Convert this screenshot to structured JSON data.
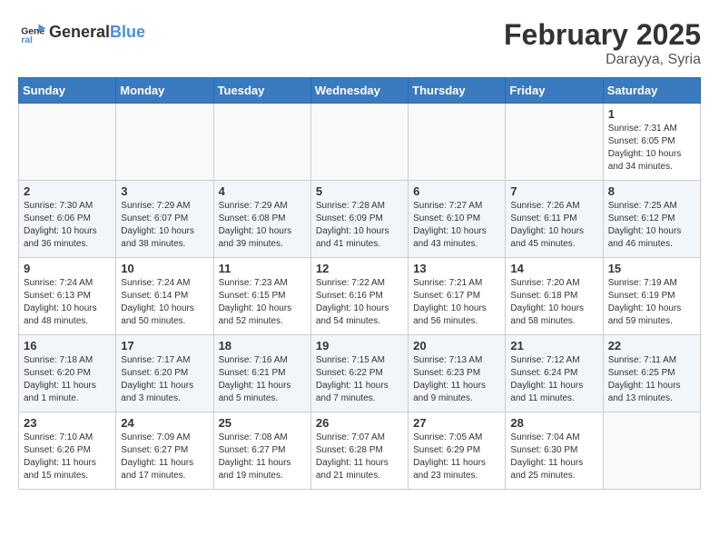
{
  "header": {
    "logo_line1": "General",
    "logo_line2": "Blue",
    "month": "February 2025",
    "location": "Darayya, Syria"
  },
  "days_of_week": [
    "Sunday",
    "Monday",
    "Tuesday",
    "Wednesday",
    "Thursday",
    "Friday",
    "Saturday"
  ],
  "weeks": [
    [
      {
        "day": "",
        "info": ""
      },
      {
        "day": "",
        "info": ""
      },
      {
        "day": "",
        "info": ""
      },
      {
        "day": "",
        "info": ""
      },
      {
        "day": "",
        "info": ""
      },
      {
        "day": "",
        "info": ""
      },
      {
        "day": "1",
        "info": "Sunrise: 7:31 AM\nSunset: 6:05 PM\nDaylight: 10 hours and 34 minutes."
      }
    ],
    [
      {
        "day": "2",
        "info": "Sunrise: 7:30 AM\nSunset: 6:06 PM\nDaylight: 10 hours and 36 minutes."
      },
      {
        "day": "3",
        "info": "Sunrise: 7:29 AM\nSunset: 6:07 PM\nDaylight: 10 hours and 38 minutes."
      },
      {
        "day": "4",
        "info": "Sunrise: 7:29 AM\nSunset: 6:08 PM\nDaylight: 10 hours and 39 minutes."
      },
      {
        "day": "5",
        "info": "Sunrise: 7:28 AM\nSunset: 6:09 PM\nDaylight: 10 hours and 41 minutes."
      },
      {
        "day": "6",
        "info": "Sunrise: 7:27 AM\nSunset: 6:10 PM\nDaylight: 10 hours and 43 minutes."
      },
      {
        "day": "7",
        "info": "Sunrise: 7:26 AM\nSunset: 6:11 PM\nDaylight: 10 hours and 45 minutes."
      },
      {
        "day": "8",
        "info": "Sunrise: 7:25 AM\nSunset: 6:12 PM\nDaylight: 10 hours and 46 minutes."
      }
    ],
    [
      {
        "day": "9",
        "info": "Sunrise: 7:24 AM\nSunset: 6:13 PM\nDaylight: 10 hours and 48 minutes."
      },
      {
        "day": "10",
        "info": "Sunrise: 7:24 AM\nSunset: 6:14 PM\nDaylight: 10 hours and 50 minutes."
      },
      {
        "day": "11",
        "info": "Sunrise: 7:23 AM\nSunset: 6:15 PM\nDaylight: 10 hours and 52 minutes."
      },
      {
        "day": "12",
        "info": "Sunrise: 7:22 AM\nSunset: 6:16 PM\nDaylight: 10 hours and 54 minutes."
      },
      {
        "day": "13",
        "info": "Sunrise: 7:21 AM\nSunset: 6:17 PM\nDaylight: 10 hours and 56 minutes."
      },
      {
        "day": "14",
        "info": "Sunrise: 7:20 AM\nSunset: 6:18 PM\nDaylight: 10 hours and 58 minutes."
      },
      {
        "day": "15",
        "info": "Sunrise: 7:19 AM\nSunset: 6:19 PM\nDaylight: 10 hours and 59 minutes."
      }
    ],
    [
      {
        "day": "16",
        "info": "Sunrise: 7:18 AM\nSunset: 6:20 PM\nDaylight: 11 hours and 1 minute."
      },
      {
        "day": "17",
        "info": "Sunrise: 7:17 AM\nSunset: 6:20 PM\nDaylight: 11 hours and 3 minutes."
      },
      {
        "day": "18",
        "info": "Sunrise: 7:16 AM\nSunset: 6:21 PM\nDaylight: 11 hours and 5 minutes."
      },
      {
        "day": "19",
        "info": "Sunrise: 7:15 AM\nSunset: 6:22 PM\nDaylight: 11 hours and 7 minutes."
      },
      {
        "day": "20",
        "info": "Sunrise: 7:13 AM\nSunset: 6:23 PM\nDaylight: 11 hours and 9 minutes."
      },
      {
        "day": "21",
        "info": "Sunrise: 7:12 AM\nSunset: 6:24 PM\nDaylight: 11 hours and 11 minutes."
      },
      {
        "day": "22",
        "info": "Sunrise: 7:11 AM\nSunset: 6:25 PM\nDaylight: 11 hours and 13 minutes."
      }
    ],
    [
      {
        "day": "23",
        "info": "Sunrise: 7:10 AM\nSunset: 6:26 PM\nDaylight: 11 hours and 15 minutes."
      },
      {
        "day": "24",
        "info": "Sunrise: 7:09 AM\nSunset: 6:27 PM\nDaylight: 11 hours and 17 minutes."
      },
      {
        "day": "25",
        "info": "Sunrise: 7:08 AM\nSunset: 6:27 PM\nDaylight: 11 hours and 19 minutes."
      },
      {
        "day": "26",
        "info": "Sunrise: 7:07 AM\nSunset: 6:28 PM\nDaylight: 11 hours and 21 minutes."
      },
      {
        "day": "27",
        "info": "Sunrise: 7:05 AM\nSunset: 6:29 PM\nDaylight: 11 hours and 23 minutes."
      },
      {
        "day": "28",
        "info": "Sunrise: 7:04 AM\nSunset: 6:30 PM\nDaylight: 11 hours and 25 minutes."
      },
      {
        "day": "",
        "info": ""
      }
    ]
  ]
}
